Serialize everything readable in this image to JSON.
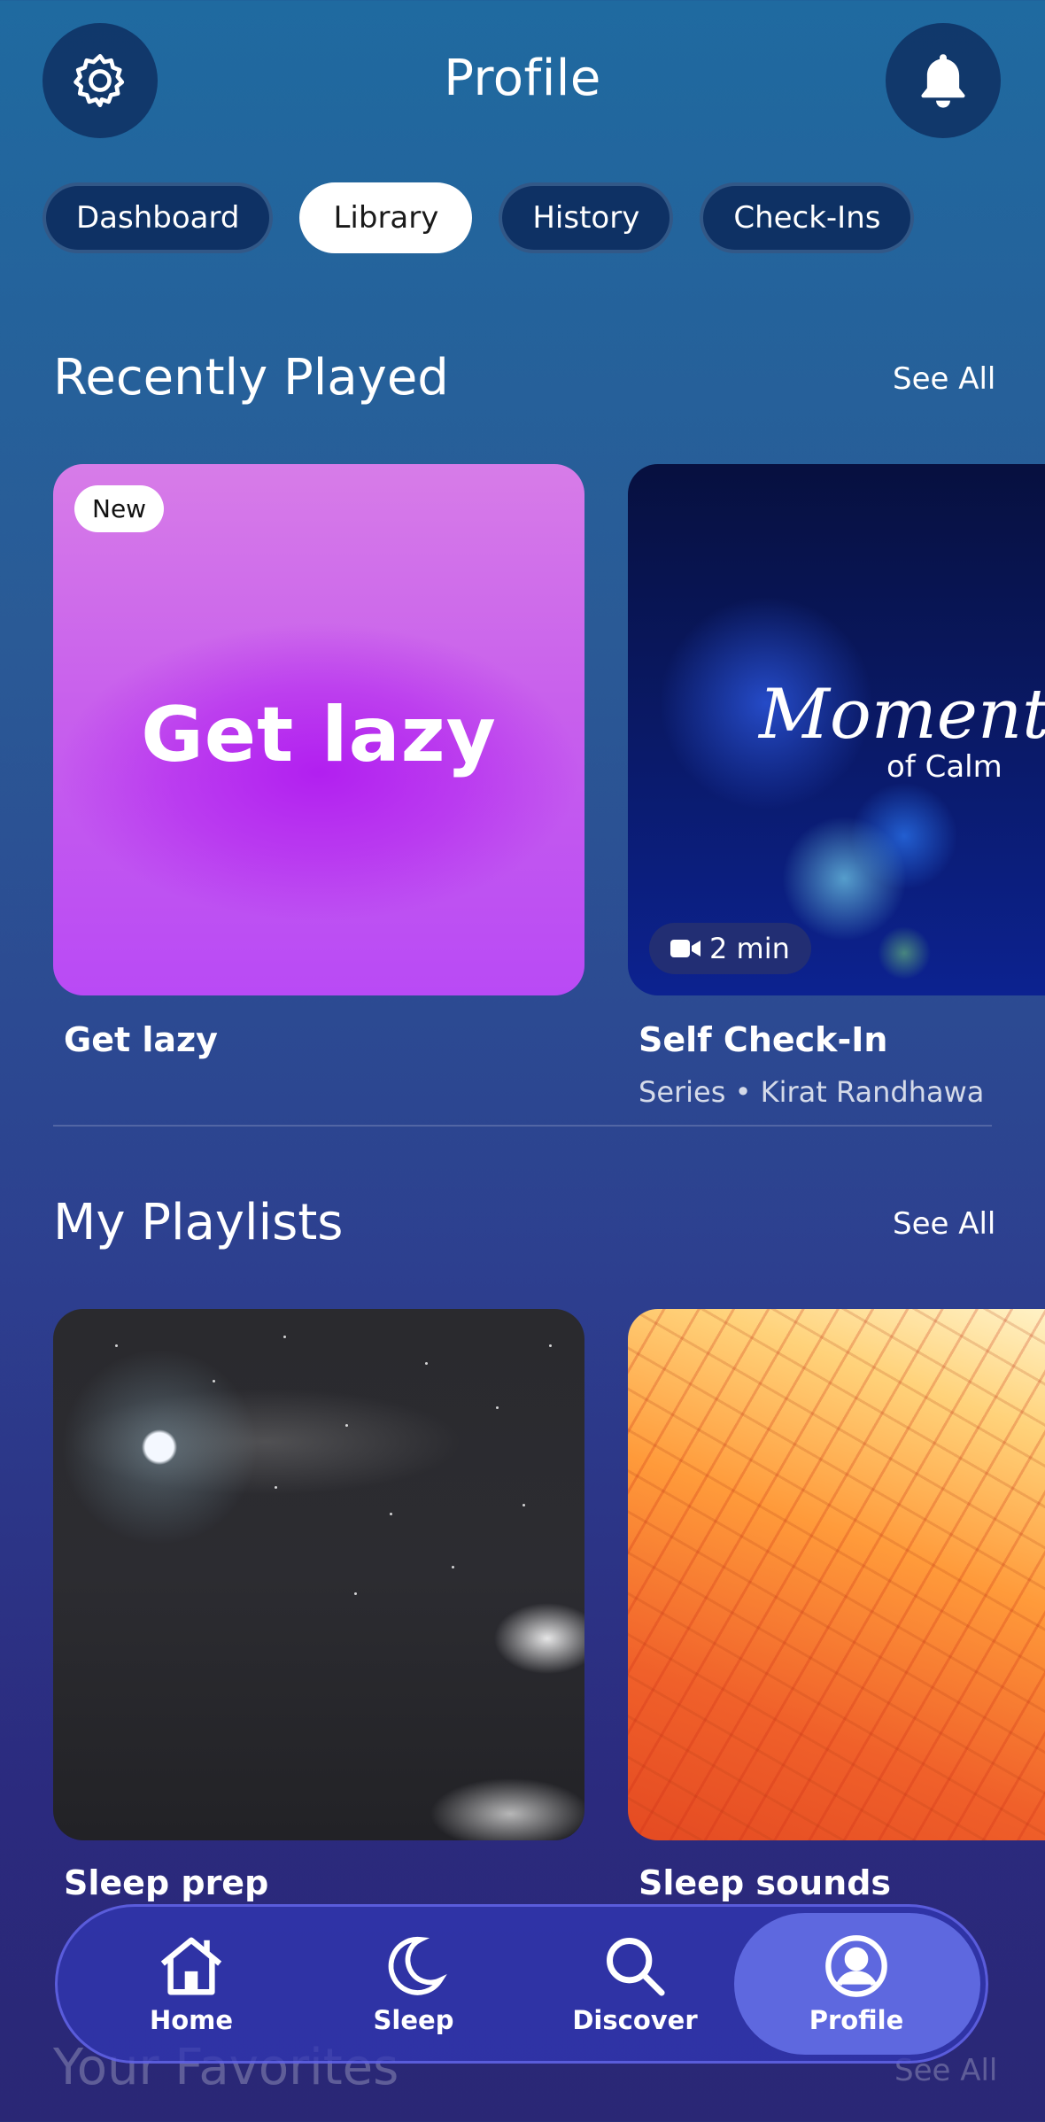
{
  "header": {
    "title": "Profile"
  },
  "tabs": [
    {
      "label": "Dashboard",
      "active": false
    },
    {
      "label": "Library",
      "active": true
    },
    {
      "label": "History",
      "active": false
    },
    {
      "label": "Check-Ins",
      "active": false
    }
  ],
  "recently_played": {
    "title": "Recently Played",
    "see_all": "See All",
    "items": [
      {
        "badge": "New",
        "cover_text": "Get lazy",
        "title": "Get lazy"
      },
      {
        "cover_script": "Moment",
        "cover_sub": "of Calm",
        "duration": "2 min",
        "duration_icon": "video-camera-icon",
        "title": "Self Check-In",
        "subtitle": "Series • Kirat Randhawa"
      }
    ]
  },
  "my_playlists": {
    "title": "My Playlists",
    "see_all": "See All",
    "items": [
      {
        "title": "Sleep prep"
      },
      {
        "title": "Sleep sounds"
      }
    ]
  },
  "next_section": {
    "title": "Your Favorites",
    "see_all": "See All"
  },
  "bottom_nav": [
    {
      "label": "Home",
      "icon": "home-icon",
      "active": false
    },
    {
      "label": "Sleep",
      "icon": "moon-icon",
      "active": false
    },
    {
      "label": "Discover",
      "icon": "search-icon",
      "active": false
    },
    {
      "label": "Profile",
      "icon": "profile-icon",
      "active": true
    }
  ],
  "colors": {
    "active_tab_bg": "#ffffff",
    "nav_bg": "#3237b4",
    "nav_active": "#646ee6"
  }
}
